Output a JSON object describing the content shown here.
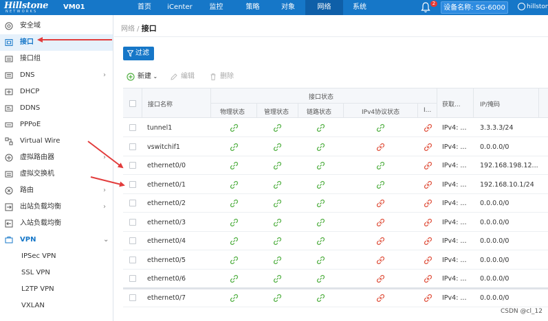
{
  "brand": {
    "logo": "Hillstone",
    "logo_sub": "NETWORKS",
    "vm": "VM01"
  },
  "nav": [
    {
      "label": "首页",
      "active": false
    },
    {
      "label": "iCenter",
      "active": false
    },
    {
      "label": "监控",
      "active": false
    },
    {
      "label": "策略",
      "active": false
    },
    {
      "label": "对象",
      "active": false
    },
    {
      "label": "网络",
      "active": true
    },
    {
      "label": "系统",
      "active": false
    }
  ],
  "header": {
    "bell_count": "2",
    "device_label": "设备名称: SG-6000",
    "user": "hillstone"
  },
  "sidebar": {
    "items": [
      {
        "label": "安全域",
        "icon": "security-zone-icon"
      },
      {
        "label": "接口",
        "icon": "interface-icon",
        "active": true
      },
      {
        "label": "接口组",
        "icon": "interface-group-icon"
      },
      {
        "label": "DNS",
        "icon": "dns-icon",
        "chevron": true
      },
      {
        "label": "DHCP",
        "icon": "dhcp-icon"
      },
      {
        "label": "DDNS",
        "icon": "ddns-icon"
      },
      {
        "label": "PPPoE",
        "icon": "pppoe-icon"
      },
      {
        "label": "Virtual Wire",
        "icon": "virtual-wire-icon"
      },
      {
        "label": "虚拟路由器",
        "icon": "virtual-router-icon",
        "chevron": true
      },
      {
        "label": "虚拟交换机",
        "icon": "virtual-switch-icon"
      },
      {
        "label": "路由",
        "icon": "route-icon",
        "chevron": true
      },
      {
        "label": "出站负载均衡",
        "icon": "outbound-lb-icon",
        "chevron": true
      },
      {
        "label": "入站负载均衡",
        "icon": "inbound-lb-icon"
      },
      {
        "label": "VPN",
        "icon": "vpn-icon",
        "chevron": true,
        "open": true
      }
    ],
    "vpn_sub": [
      "IPSec VPN",
      "SSL VPN",
      "L2TP VPN",
      "VXLAN"
    ]
  },
  "breadcrumb": {
    "parent": "网络",
    "sep": " / ",
    "current": "接口"
  },
  "filter_label": "过滤",
  "toolbar": {
    "new": "新建",
    "edit": "编辑",
    "delete": "删除"
  },
  "table": {
    "headers": {
      "name": "接口名称",
      "status_group": "接口状态",
      "physical": "物理状态",
      "admin": "管理状态",
      "link": "链路状态",
      "ipv4": "IPv4协议状态",
      "extra": "I...",
      "get": "获取...",
      "ip": "IP/掩码"
    },
    "rows": [
      {
        "name": "tunnel1",
        "status": [
          "up",
          "up",
          "up",
          "up",
          "down"
        ],
        "get": "IPv4: ...",
        "ip": "3.3.3.3/24"
      },
      {
        "name": "vswitchif1",
        "status": [
          "up",
          "up",
          "up",
          "down",
          "down"
        ],
        "get": "IPv4: ...",
        "ip": "0.0.0.0/0"
      },
      {
        "name": "ethernet0/0",
        "status": [
          "up",
          "up",
          "up",
          "up",
          "down"
        ],
        "get": "IPv4: ...",
        "ip": "192.168.198.12..."
      },
      {
        "name": "ethernet0/1",
        "status": [
          "up",
          "up",
          "up",
          "up",
          "down"
        ],
        "get": "IPv4: ...",
        "ip": "192.168.10.1/24"
      },
      {
        "name": "ethernet0/2",
        "status": [
          "up",
          "up",
          "up",
          "down",
          "down"
        ],
        "get": "IPv4: ...",
        "ip": "0.0.0.0/0"
      },
      {
        "name": "ethernet0/3",
        "status": [
          "up",
          "up",
          "up",
          "down",
          "down"
        ],
        "get": "IPv4: ...",
        "ip": "0.0.0.0/0"
      },
      {
        "name": "ethernet0/4",
        "status": [
          "up",
          "up",
          "up",
          "down",
          "down"
        ],
        "get": "IPv4: ...",
        "ip": "0.0.0.0/0"
      },
      {
        "name": "ethernet0/5",
        "status": [
          "up",
          "up",
          "up",
          "down",
          "down"
        ],
        "get": "IPv4: ...",
        "ip": "0.0.0.0/0"
      },
      {
        "name": "ethernet0/6",
        "status": [
          "up",
          "up",
          "up",
          "down",
          "down"
        ],
        "get": "IPv4: ...",
        "ip": "0.0.0.0/0"
      },
      {
        "name": "ethernet0/7",
        "status": [
          "up",
          "up",
          "up",
          "down",
          "down"
        ],
        "get": "IPv4: ...",
        "ip": "0.0.0.0/0"
      }
    ]
  },
  "colors": {
    "primary": "#1677c8",
    "link_up": "#52b043",
    "link_down": "#e0533f",
    "annotation_arrow": "#e23b3b"
  },
  "watermark": "CSDN @cl_12"
}
